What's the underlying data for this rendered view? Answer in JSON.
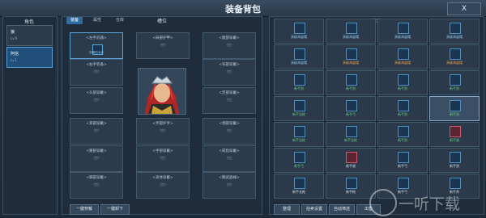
{
  "window": {
    "title": "装备背包",
    "close_label": "X"
  },
  "left_panel": {
    "header": "角色",
    "characters": [
      {
        "name": "狼",
        "level": "Lv.9",
        "active": false
      },
      {
        "name": "阿信",
        "level": "Lv.1",
        "active": true
      }
    ]
  },
  "center_panel": {
    "tabs": [
      "装备",
      "属性",
      "仓库"
    ],
    "header": "槽位",
    "slots": [
      {
        "label": "<左手武器>",
        "sub": "(空)",
        "equipped_name": "奴隶的木剑"
      },
      {
        "label": "<肩部护甲>",
        "sub": "(空)"
      },
      {
        "label": "<腿部穿戴>",
        "sub": "(空)"
      },
      {
        "label": "<右手装备>",
        "sub": "(空)"
      },
      {
        "label": "<背部穿戴>",
        "sub": "(空)"
      },
      {
        "label": "<头部穿戴>",
        "sub": "(空)"
      },
      {
        "label": "<足部穿戴>",
        "sub": "(空)"
      },
      {
        "label": "<颈部穿戴>",
        "sub": "(空)"
      },
      {
        "label": "<手部护手>",
        "sub": "(空)"
      },
      {
        "label": "<戒指穿戴>",
        "sub": "(空)"
      },
      {
        "label": "<耳部穿戴>",
        "sub": "(空)"
      },
      {
        "label": "<手部穿戴>",
        "sub": "(空)"
      },
      {
        "label": "<腰部穿戴>",
        "sub": "(空)"
      },
      {
        "label": "<脚部穿戴>",
        "sub": "(空)"
      },
      {
        "label": "<身体穿戴>",
        "sub": "(空)"
      },
      {
        "label": "<胸武器械>",
        "sub": "(空)"
      }
    ],
    "buttons": {
      "equip_all": "一键穿戴",
      "unequip_all": "一键卸下"
    }
  },
  "right_panel": {
    "header": "清单",
    "items": [
      {
        "name": "高级海盗帽",
        "color": "blue",
        "icon": "sword"
      },
      {
        "name": "高级海盗帽",
        "color": "blue",
        "icon": "sword"
      },
      {
        "name": "高级海盗帽",
        "color": "blue",
        "icon": "sword"
      },
      {
        "name": "高级海盗帽",
        "color": "blue",
        "icon": "sword"
      },
      {
        "name": "高级海盗帽",
        "color": "blue",
        "icon": "sword"
      },
      {
        "name": "高级海盗帽",
        "color": "orange",
        "icon": "sword"
      },
      {
        "name": "高级海盗帽",
        "color": "orange",
        "icon": "sword"
      },
      {
        "name": "高级海盗帽",
        "color": "orange",
        "icon": "sword"
      },
      {
        "name": "新手剑",
        "color": "green",
        "icon": "sword"
      },
      {
        "name": "新手剑",
        "color": "green",
        "icon": "sword"
      },
      {
        "name": "新手剑",
        "color": "green",
        "icon": "sword"
      },
      {
        "name": "新手剑",
        "color": "green",
        "icon": "sword"
      },
      {
        "name": "新手法杖",
        "color": "green",
        "icon": "sword"
      },
      {
        "name": "新手弓",
        "color": "green",
        "icon": "sword"
      },
      {
        "name": "新手剑",
        "color": "green",
        "icon": "sword"
      },
      {
        "name": "新手剑",
        "color": "green",
        "icon": "sword"
      },
      {
        "name": "新手法杖",
        "color": "green",
        "icon": "sword"
      },
      {
        "name": "新手法杖",
        "color": "green",
        "icon": "sword"
      },
      {
        "name": "新手剑",
        "color": "green",
        "icon": "sword"
      },
      {
        "name": "新手盾",
        "color": "green",
        "icon": "shield"
      },
      {
        "name": "新手弓",
        "color": "green",
        "icon": "sword"
      },
      {
        "name": "新手盾",
        "color": "white",
        "icon": "shield"
      },
      {
        "name": "新手弓",
        "color": "white",
        "icon": "sword"
      },
      {
        "name": "新手剑",
        "color": "white",
        "icon": "sword"
      },
      {
        "name": "新手长枪",
        "color": "white",
        "icon": "sword"
      },
      {
        "name": "新手枪",
        "color": "white",
        "icon": "sword"
      },
      {
        "name": "新手弓",
        "color": "white",
        "icon": "sword"
      },
      {
        "name": "新手斧",
        "color": "white",
        "icon": "sword"
      }
    ],
    "bottom_buttons": [
      "整理",
      "拍卖设置",
      "自动筛选",
      "出售"
    ]
  },
  "watermark": {
    "text": "一听下载"
  },
  "colors": {
    "accent": "#2f6aa0",
    "highlight": "#5aa4d6",
    "rare": "#f0a040",
    "common": "#6ed48a"
  }
}
